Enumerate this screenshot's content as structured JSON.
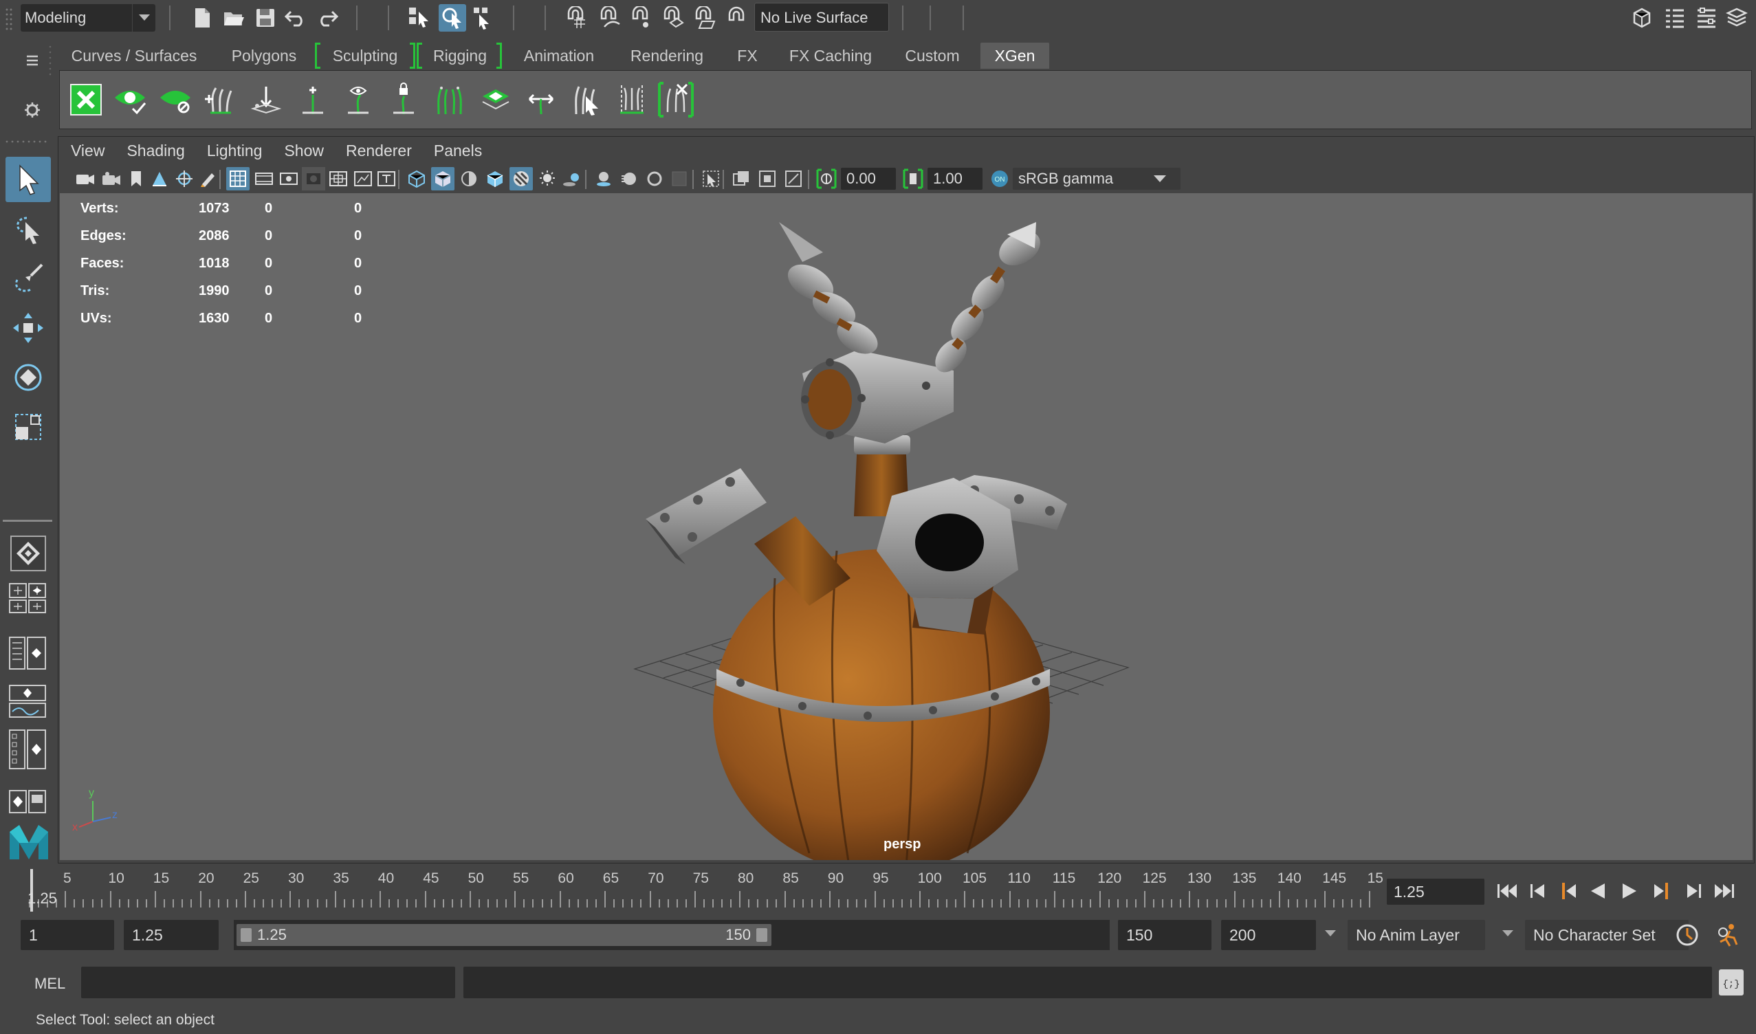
{
  "status_line": {
    "mode": "Modeling",
    "live_surface": "No Live Surface"
  },
  "shelf": {
    "tabs": [
      {
        "label": "Curves / Surfaces"
      },
      {
        "label": "Polygons"
      },
      {
        "label": "Sculpting"
      },
      {
        "label": "Rigging"
      },
      {
        "label": "Animation"
      },
      {
        "label": "Rendering"
      },
      {
        "label": "FX"
      },
      {
        "label": "FX Caching"
      },
      {
        "label": "Custom"
      },
      {
        "label": "XGen"
      }
    ],
    "active_tab": "XGen"
  },
  "panel": {
    "menus": [
      "View",
      "Shading",
      "Lighting",
      "Show",
      "Renderer",
      "Panels"
    ],
    "exposure": "0.00",
    "gamma": "1.00",
    "color_space": "sRGB gamma",
    "camera": "persp"
  },
  "hud": {
    "rows": [
      {
        "label": "Verts:",
        "v1": "1073",
        "v2": "0",
        "v3": "0"
      },
      {
        "label": "Edges:",
        "v1": "2086",
        "v2": "0",
        "v3": "0"
      },
      {
        "label": "Faces:",
        "v1": "1018",
        "v2": "0",
        "v3": "0"
      },
      {
        "label": "Tris:",
        "v1": "1990",
        "v2": "0",
        "v3": "0"
      },
      {
        "label": "UVs:",
        "v1": "1630",
        "v2": "0",
        "v3": "0"
      }
    ]
  },
  "axis": {
    "x": "x",
    "y": "y",
    "z": "z"
  },
  "time_slider": {
    "ticks": [
      "5",
      "10",
      "15",
      "20",
      "25",
      "30",
      "35",
      "40",
      "45",
      "50",
      "55",
      "60",
      "65",
      "70",
      "75",
      "80",
      "85",
      "90",
      "95",
      "100",
      "105",
      "110",
      "115",
      "120",
      "125",
      "130",
      "135",
      "140",
      "145",
      "15"
    ],
    "current_frame_marker": "1.25",
    "current_time": "1.25"
  },
  "range_slider": {
    "start": "1",
    "playback_start": "1.25",
    "handle_start": "1.25",
    "handle_end": "150",
    "playback_end": "150",
    "end": "200",
    "anim_layer": "No Anim Layer",
    "character_set": "No Character Set"
  },
  "command_line": {
    "language": "MEL",
    "input": "",
    "result": ""
  },
  "help_line": "Select Tool: select an object",
  "colors": {
    "accent": "#5285a6",
    "xgen_green": "#27c33a",
    "panel_bg": "#444444",
    "viewport_bg": "#686868"
  }
}
